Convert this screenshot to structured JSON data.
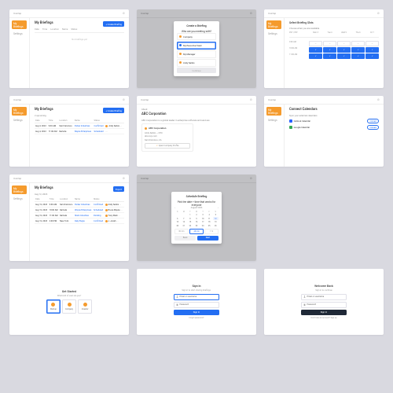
{
  "brand": "Overlap",
  "nav": {
    "briefings": "My Briefings",
    "settings": "Settings"
  },
  "gear": "Settings",
  "screens": {
    "s1": {
      "title": "My Briefings",
      "tabs": [
        "Date",
        "Time",
        "Location",
        "Name",
        "Status"
      ],
      "cta": "+ Create Briefing",
      "empty": "No briefings yet"
    },
    "s2": {
      "title": "Create a Briefing",
      "sub": "Who are you meeting with?",
      "opts": [
        "Company",
        "My Executive Team",
        "My Manager",
        "Andy Serkis"
      ],
      "btn": "Continue"
    },
    "s3": {
      "title": "Select Briefing Slots",
      "sub": "Choose when you are available",
      "timecol": "PST / EST",
      "days": [
        "Mon 3",
        "Tue 4",
        "Wed 5",
        "Thu 6",
        "Fri 7"
      ],
      "times": [
        "9:00 AM",
        "10:00 AM",
        "11:00 AM"
      ],
      "slotSelIdx": [
        5,
        6,
        7,
        8,
        9,
        10,
        11,
        12,
        13,
        14
      ]
    },
    "s4": {
      "title": "My Briefings",
      "sub": "2 upcoming",
      "cta": "+ Create Briefing",
      "cols": [
        "Date",
        "Time",
        "Location",
        "Name",
        "Status",
        ""
      ],
      "rows": [
        [
          "Aug 3, 2023",
          "9:00 AM",
          "San Francisco",
          "Parker Industries",
          "Confirmed",
          "Andy Serkis"
        ],
        [
          "Aug 4, 2023",
          "11:00 AM",
          "Remote",
          "Wayne Enterprises",
          "Scheduled",
          ""
        ]
      ]
    },
    "s5": {
      "title": "About",
      "name": "ABC Corporation",
      "about": "ABC Corporation is a global leader in enterprise software and services.",
      "lines": [
        "Andy Serkis — CEO",
        "abccorp.com",
        "San Francisco, CA"
      ],
      "btn": "Open Company Profile"
    },
    "s6": {
      "title": "Connect Calendars",
      "sub": "Sync your external calendars",
      "outlook": "Outlook Calendar",
      "google": "Google Calendar",
      "connect": "Connect",
      "connected": "Connected"
    },
    "s7": {
      "title": "My Briefings",
      "sub": "Aug 12, 2023",
      "cta": "Export",
      "cols": [
        "Date",
        "Time",
        "Location",
        "Name",
        "Status",
        ""
      ],
      "rows": [
        [
          "Aug 12, 2023",
          "9:00 AM",
          "San Francisco",
          "Parker Industries",
          "Confirmed",
          "Andy Serkis"
        ],
        [
          "Aug 12, 2023",
          "10:00 AM",
          "Remote",
          "Wayne Enterprises",
          "Scheduled",
          "Bruce Wayne"
        ],
        [
          "Aug 12, 2023",
          "11:00 AM",
          "Remote",
          "Stark Industries",
          "Pending",
          "Tony Stark"
        ],
        [
          "Aug 12, 2023",
          "2:00 PM",
          "New York",
          "Daily Bugle",
          "Confirmed",
          "J. Jonah"
        ]
      ]
    },
    "s8": {
      "title": "Schedule Briefing",
      "sub": "Pick the date + time that works for everyone",
      "month": "August 2023",
      "wk": [
        "S",
        "M",
        "T",
        "W",
        "T",
        "F",
        "S"
      ],
      "days": [
        "",
        "",
        "1",
        "2",
        "3",
        "4",
        "5",
        "6",
        "7",
        "8",
        "9",
        "10",
        "11",
        "12",
        "13",
        "14",
        "15",
        "16",
        "17",
        "18",
        "19",
        "20",
        "21",
        "22",
        "23",
        "24",
        "25",
        "26",
        "27",
        "28",
        "29",
        "30",
        "31",
        "",
        ""
      ],
      "selDay": "12",
      "durs": [
        "30 min",
        "45 min",
        "1 hr"
      ],
      "back": "Back",
      "next": "Next"
    },
    "s9": {
      "title": "Get Started",
      "sub": "What kind of user are you?",
      "opts": [
        "Startup",
        "Company",
        "Investor"
      ]
    },
    "s10": {
      "title": "Sign In",
      "sub": "Sign in to start sharing briefings.",
      "user": "Email or username",
      "pass": "Password",
      "btn": "Sign In",
      "forgot": "Forgot password?"
    },
    "s11": {
      "title": "Welcome Back",
      "sub": "Sign in to continue",
      "user": "Email or username",
      "pass": "Password",
      "btn": "Sign In",
      "caption": "Don't have an account? Sign up"
    }
  }
}
